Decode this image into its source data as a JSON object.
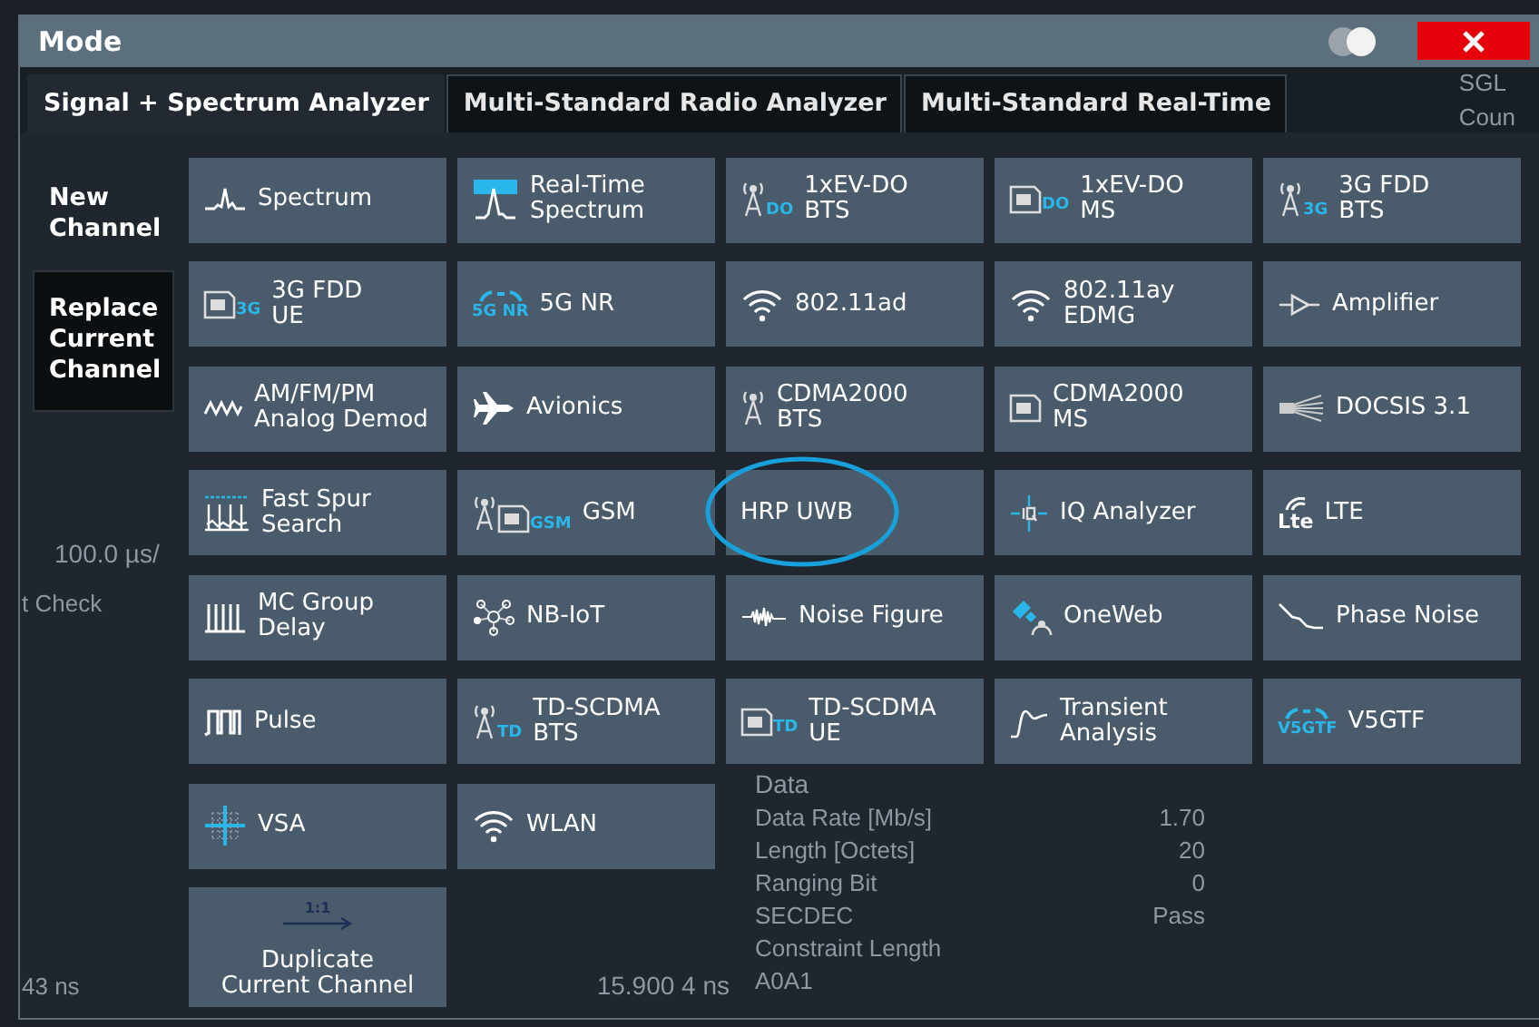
{
  "background": {
    "top_right": [
      "SGL",
      "Coun"
    ],
    "axis_label": "100.0 µs/",
    "side_label": "t Check",
    "table": {
      "heading": "Data",
      "rows": [
        {
          "name": "Data Rate [Mb/s]",
          "value": "1.70"
        },
        {
          "name": "Length [Octets]",
          "value": "20"
        },
        {
          "name": "Ranging Bit",
          "value": "0"
        },
        {
          "name": "SECDEC",
          "value": "Pass"
        },
        {
          "name": "Constraint Length",
          "value": ""
        },
        {
          "name": "A0A1",
          "value": ""
        }
      ]
    },
    "bottom_left": "43 ns",
    "bottom_mid": "15.900 4 ns"
  },
  "window": {
    "title": "Mode",
    "toggle_on": true
  },
  "tabs": [
    {
      "label": "Signal + Spectrum Analyzer",
      "selected": true
    },
    {
      "label": "Multi-Standard Radio Analyzer",
      "selected": false
    },
    {
      "label": "Multi-Standard Real-Time",
      "selected": false
    }
  ],
  "sidebar": {
    "items": [
      {
        "label": "New Channel",
        "selected": true
      },
      {
        "label": "Replace Current Channel",
        "selected": false
      }
    ]
  },
  "modes": [
    {
      "kind": "mode",
      "label": "Spectrum",
      "circled": false
    },
    {
      "kind": "mode",
      "label": "Real-Time\nSpectrum",
      "circled": false
    },
    {
      "kind": "mode",
      "label": "1xEV-DO\nBTS",
      "badge": "DO",
      "circled": false
    },
    {
      "kind": "mode",
      "label": "1xEV-DO\nMS",
      "badge": "DO",
      "circled": false
    },
    {
      "kind": "mode",
      "label": "3G FDD\nBTS",
      "badge": "3G",
      "circled": false
    },
    {
      "kind": "mode",
      "label": "3G FDD\nUE",
      "badge": "3G",
      "circled": false
    },
    {
      "kind": "mode",
      "label": "5G NR",
      "badge": "5G NR",
      "circled": false
    },
    {
      "kind": "mode",
      "label": "802.11ad",
      "circled": false
    },
    {
      "kind": "mode",
      "label": "802.11ay\nEDMG",
      "circled": false
    },
    {
      "kind": "mode",
      "label": "Amplifier",
      "circled": false
    },
    {
      "kind": "mode",
      "label": "AM/FM/PM\nAnalog Demod",
      "circled": false
    },
    {
      "kind": "mode",
      "label": "Avionics",
      "circled": false
    },
    {
      "kind": "mode",
      "label": "CDMA2000\nBTS",
      "circled": false
    },
    {
      "kind": "mode",
      "label": "CDMA2000\nMS",
      "circled": false
    },
    {
      "kind": "mode",
      "label": "DOCSIS 3.1",
      "circled": false
    },
    {
      "kind": "mode",
      "label": "Fast Spur\nSearch",
      "circled": false
    },
    {
      "kind": "mode",
      "label": "GSM",
      "badge": "GSM",
      "circled": false
    },
    {
      "kind": "mode",
      "label": "HRP UWB",
      "circled": true
    },
    {
      "kind": "mode",
      "label": "IQ Analyzer",
      "circled": false
    },
    {
      "kind": "mode",
      "label": "LTE",
      "badge": "Lte",
      "circled": false
    },
    {
      "kind": "mode",
      "label": "MC Group\nDelay",
      "circled": false
    },
    {
      "kind": "mode",
      "label": "NB-IoT",
      "circled": false
    },
    {
      "kind": "mode",
      "label": "Noise Figure",
      "circled": false
    },
    {
      "kind": "mode",
      "label": "OneWeb",
      "circled": false
    },
    {
      "kind": "mode",
      "label": "Phase Noise",
      "circled": false
    },
    {
      "kind": "mode",
      "label": "Pulse",
      "circled": false
    },
    {
      "kind": "mode",
      "label": "TD-SCDMA\nBTS",
      "badge": "TD",
      "circled": false
    },
    {
      "kind": "mode",
      "label": "TD-SCDMA\nUE",
      "badge": "TD",
      "circled": false
    },
    {
      "kind": "mode",
      "label": "Transient\nAnalysis",
      "circled": false
    },
    {
      "kind": "mode",
      "label": "V5GTF",
      "badge": "V5GTF",
      "circled": false
    },
    {
      "kind": "mode",
      "label": "VSA",
      "circled": false
    },
    {
      "kind": "mode",
      "label": "WLAN",
      "circled": false
    },
    {
      "kind": "action",
      "label": "Duplicate\nCurrent Channel",
      "badge": "1:1",
      "circled": false
    }
  ]
}
